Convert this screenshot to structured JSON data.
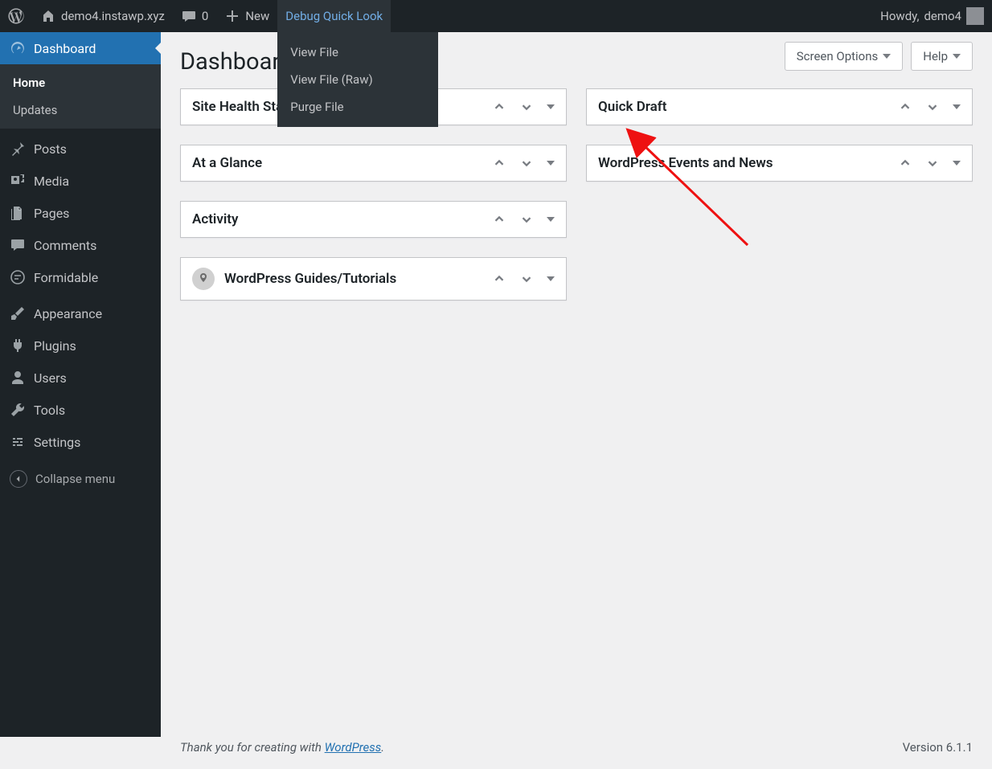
{
  "adminbar": {
    "site_name": "demo4.instawp.xyz",
    "comment_count": "0",
    "new_label": "New",
    "debug_label": "Debug Quick Look",
    "debug_items": [
      "View File",
      "View File (Raw)",
      "Purge File"
    ],
    "howdy_prefix": "Howdy, ",
    "user_name": "demo4"
  },
  "sidebar": {
    "items": [
      {
        "label": "Dashboard",
        "icon": "dashboard",
        "current": true
      },
      {
        "label": "Posts",
        "icon": "pin"
      },
      {
        "label": "Media",
        "icon": "media"
      },
      {
        "label": "Pages",
        "icon": "pages"
      },
      {
        "label": "Comments",
        "icon": "comment"
      },
      {
        "label": "Formidable",
        "icon": "form"
      },
      {
        "label": "Appearance",
        "icon": "brush"
      },
      {
        "label": "Plugins",
        "icon": "plug"
      },
      {
        "label": "Users",
        "icon": "user"
      },
      {
        "label": "Tools",
        "icon": "wrench"
      },
      {
        "label": "Settings",
        "icon": "settings"
      }
    ],
    "submenu": [
      "Home",
      "Updates"
    ],
    "collapse_label": "Collapse menu"
  },
  "page": {
    "title": "Dashboard",
    "screen_options": "Screen Options",
    "help": "Help"
  },
  "boxes": {
    "left": [
      {
        "title": "Site Health Status"
      },
      {
        "title": "At a Glance"
      },
      {
        "title": "Activity"
      },
      {
        "title": "WordPress Guides/Tutorials",
        "hasImage": true
      }
    ],
    "right": [
      {
        "title": "Quick Draft"
      },
      {
        "title": "WordPress Events and News"
      }
    ]
  },
  "footer": {
    "thanks_prefix": "Thank you for creating with ",
    "wp": "WordPress",
    "thanks_suffix": ".",
    "version": "Version 6.1.1"
  }
}
